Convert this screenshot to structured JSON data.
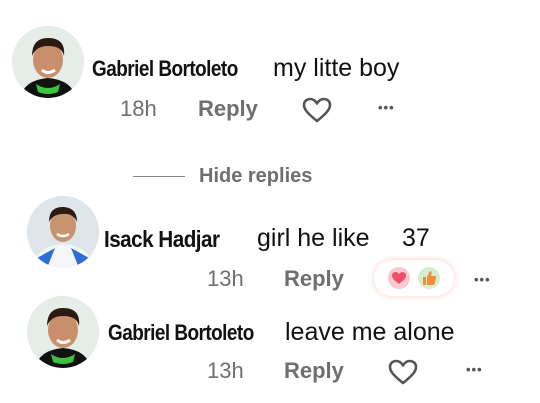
{
  "comments": [
    {
      "author": "Gabriel Bortoleto",
      "text": "my litte boy",
      "time": "18h",
      "reply_label": "Reply",
      "more_label": "•••"
    },
    {
      "author": "Isack Hadjar",
      "text": "girl he like",
      "likes": "37",
      "time": "13h",
      "reply_label": "Reply",
      "more_label": "•••"
    },
    {
      "author": "Gabriel Bortoleto",
      "text": "leave me alone",
      "time": "13h",
      "reply_label": "Reply",
      "more_label": "•••"
    }
  ],
  "thread": {
    "hide_replies_label": "Hide replies"
  },
  "icons": {
    "like": "heart-outline-icon",
    "more": "ellipsis-icon",
    "reaction_love": "heart-eyes-reaction-icon",
    "reaction_like": "thumbs-up-reaction-icon"
  },
  "colors": {
    "meta_text": "#6f6f6f",
    "reaction_love": "#f04f6a",
    "reaction_like": "#f28b3b"
  }
}
